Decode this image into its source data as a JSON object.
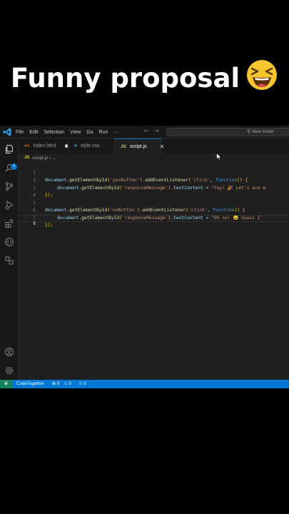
{
  "caption": {
    "text": "Funny proposal"
  },
  "menu": [
    "File",
    "Edit",
    "Selection",
    "View",
    "Go",
    "Run",
    "···"
  ],
  "search": {
    "placeholder": "New folder"
  },
  "activity": {
    "source_control_badge": "1"
  },
  "tabs": [
    {
      "label": "index.html",
      "icon": "html-file-icon"
    },
    {
      "label": "style.css",
      "icon": "css-file-icon"
    },
    {
      "label": "script.js",
      "icon": "js-file-icon"
    }
  ],
  "breadcrumb": {
    "file": "script.js",
    "rest": "› ..."
  },
  "file_icon_labels": {
    "js": "JS",
    "css": "#",
    "html": "<>"
  },
  "editor": {
    "line_numbers": [
      "1",
      "2",
      "3",
      "4",
      "5",
      "6",
      "7",
      "8"
    ],
    "line1": {
      "a": "document.",
      "b": "getElementById",
      "c": "(",
      "d": "'yesButton'",
      "e": ").",
      "f": "addEventListener",
      "g": "(",
      "h": "'click'",
      "i": ", ",
      "j": "function",
      "k": "() {"
    },
    "line2": {
      "a": "document.",
      "b": "getElementById",
      "c": "(",
      "d": "'responseMessage'",
      "e": ").",
      "f": "textContent",
      "g": " = ",
      "h": "\"Yay! 🎉 Let's ace e"
    },
    "line3": {
      "a": "});"
    },
    "line5": {
      "a": "document.",
      "b": "getElementById",
      "c": "(",
      "d": "'noButton'",
      "e": ").",
      "f": "addEventListener",
      "g": "(",
      "h": "'click'",
      "i": ", ",
      "j": "function",
      "k": "() {"
    },
    "line6": {
      "a": "document.",
      "b": "getElementById",
      "c": "(",
      "d": "'responseMessage'",
      "e": ").",
      "f": "textContent",
      "g": " = ",
      "h": "\"Oh no! 😅 Guess I'"
    },
    "line7": {
      "a": "});"
    }
  },
  "statusbar": {
    "remote": "≷",
    "live_share": "CodeTogether",
    "errors": "⊗ 0",
    "warnings": "⚠ 0",
    "ports": "☉ 0"
  },
  "colors": {
    "accent": "#0078d4",
    "editor_bg": "#1f1f1f",
    "sidebar_bg": "#181818",
    "emoji_face": "#f7c530"
  }
}
